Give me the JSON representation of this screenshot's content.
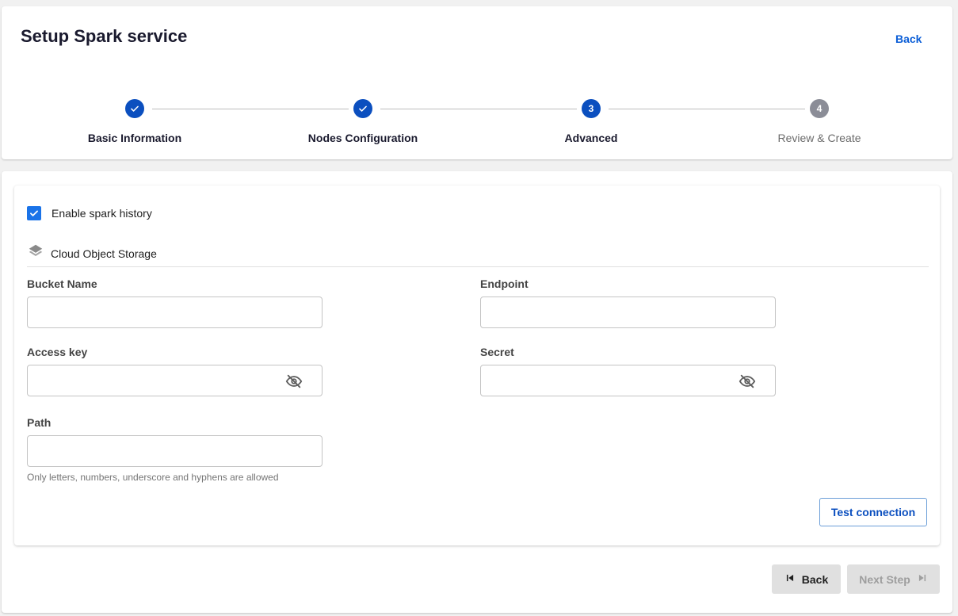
{
  "header": {
    "title": "Setup Spark service",
    "back_label": "Back"
  },
  "stepper": {
    "steps": [
      {
        "number": "1",
        "label": "Basic Information",
        "state": "done"
      },
      {
        "number": "2",
        "label": "Nodes Configuration",
        "state": "done"
      },
      {
        "number": "3",
        "label": "Advanced",
        "state": "active"
      },
      {
        "number": "4",
        "label": "Review & Create",
        "state": "pending"
      }
    ]
  },
  "form": {
    "enable_history": {
      "label": "Enable spark history",
      "checked": true
    },
    "section_title": "Cloud Object Storage",
    "bucket_name": {
      "label": "Bucket Name",
      "value": ""
    },
    "endpoint": {
      "label": "Endpoint",
      "value": ""
    },
    "access_key": {
      "label": "Access key",
      "value": ""
    },
    "secret": {
      "label": "Secret",
      "value": ""
    },
    "path": {
      "label": "Path",
      "value": "",
      "helper": "Only letters, numbers, underscore and hyphens are allowed"
    },
    "test_connection_label": "Test connection"
  },
  "footer": {
    "back_label": "Back",
    "next_label": "Next Step"
  },
  "colors": {
    "primary": "#0b4fbf",
    "checkbox": "#1a73e8",
    "pending_step": "#8b8d97"
  }
}
